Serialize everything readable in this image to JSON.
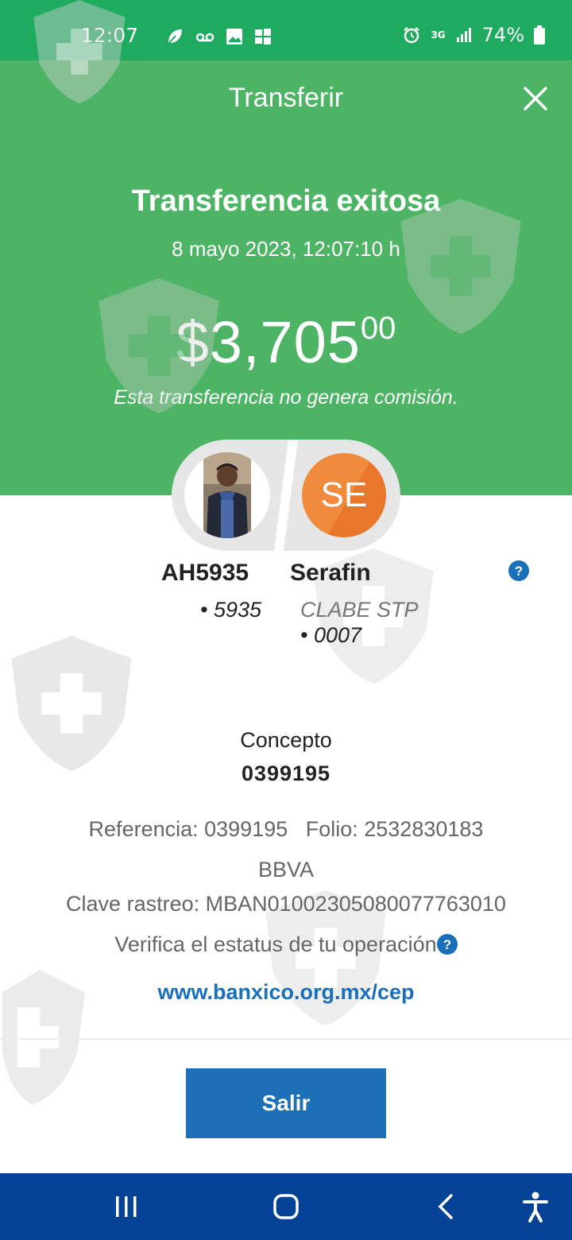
{
  "status_bar": {
    "time": "12:07",
    "battery": "74%",
    "network": "3G"
  },
  "header": {
    "title": "Transferir",
    "close_icon": "close-icon"
  },
  "result": {
    "title": "Transferencia exitosa",
    "date": "8 mayo 2023, 12:07:10 h",
    "amount_main": "$3,705",
    "amount_cents": "00",
    "fee_note": "Esta transferencia no genera comisión."
  },
  "sender": {
    "name": "AH5935",
    "account": "• 5935"
  },
  "receiver": {
    "initials": "SE",
    "name": "Serafin",
    "account_type": "CLABE STP",
    "account": "• 0007"
  },
  "details": {
    "concept_label": "Concepto",
    "concept_value": "0399195",
    "reference_line": "Referencia: 0399195   Folio: 2532830183",
    "bank": "BBVA",
    "tracking_line": "Clave rastreo: MBAN01002305080077763010",
    "verify_text": "Verifica el estatus de tu operación",
    "link": "www.banxico.org.mx/cep"
  },
  "actions": {
    "exit_label": "Salir"
  },
  "colors": {
    "header_green": "#4db465",
    "status_green": "#1eab5f",
    "button_blue": "#1d6fb7",
    "nav_blue": "#034294",
    "avatar_orange": "#f08a3c"
  }
}
